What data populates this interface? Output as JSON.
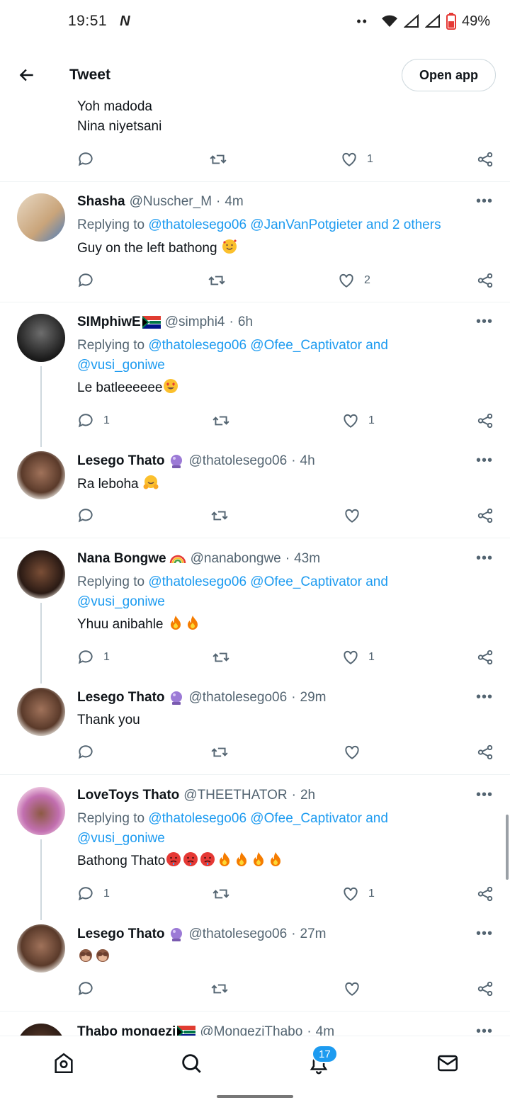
{
  "status_bar": {
    "time": "19:51",
    "app_icon": "N",
    "battery": "49%"
  },
  "header": {
    "title": "Tweet",
    "open_app": "Open app"
  },
  "top_fragment": {
    "line1": "Yoh madoda",
    "line2": "Nina niyetsani",
    "likes": "1"
  },
  "tweets": [
    {
      "name": "Shasha",
      "handle": "@Nuscher_M",
      "time": "4m",
      "replying_prefix": "Replying to ",
      "replying_links": "@thatolesego06 @JanVanPotgieter and 2 others",
      "text": "Guy on the left bathong",
      "replies": "",
      "likes": "2"
    },
    {
      "name": "SIMphiwE",
      "handle": "@simphi4",
      "time": "6h",
      "replying_prefix": "Replying to ",
      "replying_links": "@thatolesego06 @Ofee_Captivator and",
      "replying_links2": "@vusi_goniwe",
      "text": "Le batleeeeee",
      "replies": "1",
      "likes": "1"
    },
    {
      "name": "Lesego Thato",
      "handle": "@thatolesego06",
      "time": "4h",
      "text": "Ra leboha",
      "replies": "",
      "likes": ""
    },
    {
      "name": "Nana Bongwe",
      "handle": "@nanabongwe",
      "time": "43m",
      "replying_prefix": "Replying to ",
      "replying_links": "@thatolesego06 @Ofee_Captivator and",
      "replying_links2": "@vusi_goniwe",
      "text": "Yhuu anibahle",
      "replies": "1",
      "likes": "1"
    },
    {
      "name": "Lesego Thato",
      "handle": "@thatolesego06",
      "time": "29m",
      "text": "Thank you",
      "replies": "",
      "likes": ""
    },
    {
      "name": "LoveToys Thato",
      "handle": "@THEETHATOR",
      "time": "2h",
      "replying_prefix": "Replying to ",
      "replying_links": "@thatolesego06 @Ofee_Captivator and",
      "replying_links2": "@vusi_goniwe",
      "text": "Bathong Thato",
      "replies": "1",
      "likes": "1"
    },
    {
      "name": "Lesego Thato",
      "handle": "@thatolesego06",
      "time": "27m",
      "text": "",
      "replies": "",
      "likes": ""
    },
    {
      "name": "Thabo mongezi",
      "handle": "@MongeziThabo",
      "time": "4m"
    }
  ],
  "nav": {
    "notifications_count": "17"
  },
  "icons": [
    "back-arrow-icon",
    "reply-icon",
    "retweet-icon",
    "like-icon",
    "share-icon",
    "more-icon",
    "home-icon",
    "search-icon",
    "notifications-icon",
    "messages-icon"
  ],
  "colors": {
    "accent": "#1d9bf0",
    "secondary_text": "#536471",
    "divider": "#eff3f4"
  }
}
